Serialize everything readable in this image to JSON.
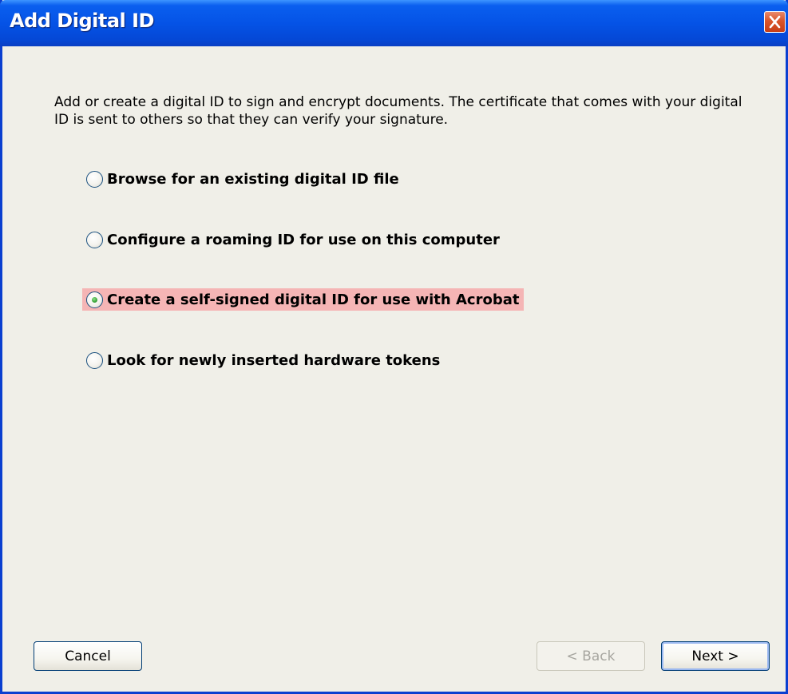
{
  "window": {
    "title": "Add Digital ID",
    "close_icon": "close-icon"
  },
  "description": "Add or create a digital ID to sign and encrypt documents. The certificate that comes with your digital ID is sent to others so that they can verify your signature.",
  "options": [
    {
      "label": "Browse for an existing digital ID file",
      "selected": false
    },
    {
      "label": "Configure a roaming ID for use on this computer",
      "selected": false
    },
    {
      "label": "Create a self-signed digital ID for use with Acrobat",
      "selected": true
    },
    {
      "label": "Look for newly inserted hardware tokens",
      "selected": false
    }
  ],
  "buttons": {
    "cancel": "Cancel",
    "back": "< Back",
    "next": "Next >"
  },
  "colors": {
    "titlebar": "#0553e6",
    "selection_highlight": "#f5b5b5",
    "dialog_background": "#f0efe8",
    "close_button": "#d9552a"
  }
}
